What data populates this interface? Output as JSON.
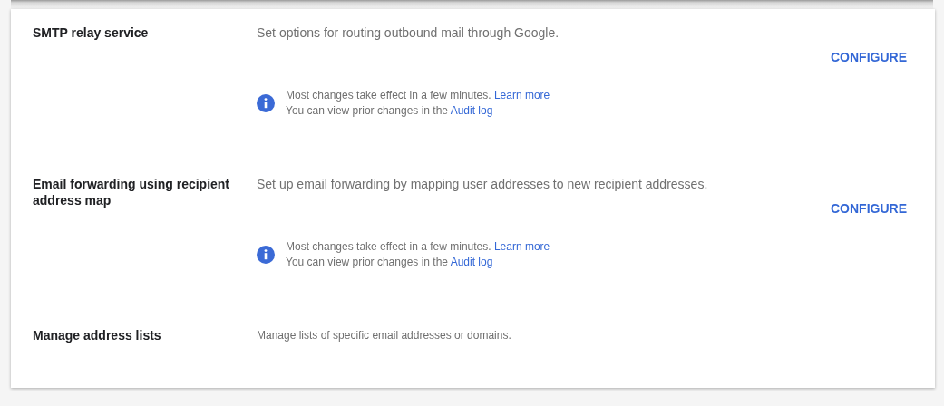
{
  "sections": [
    {
      "kind": "configurable",
      "title": "SMTP relay service",
      "description": "Set options for routing outbound mail through Google.",
      "action": "CONFIGURE",
      "notice": {
        "lines": [
          {
            "text": "Most changes take effect in a few minutes.",
            "link": "Learn more"
          },
          {
            "text": "You can view prior changes in the",
            "link": "Audit log"
          }
        ]
      }
    },
    {
      "kind": "configurable",
      "title": "Email forwarding using recipient address map",
      "description": "Set up email forwarding by mapping user addresses to new recipient addresses.",
      "action": "CONFIGURE",
      "notice": {
        "lines": [
          {
            "text": "Most changes take effect in a few minutes.",
            "link": "Learn more"
          },
          {
            "text": "You can view prior changes in the",
            "link": "Audit log"
          }
        ]
      }
    },
    {
      "kind": "summary",
      "title": "Manage address lists",
      "description": "Manage lists of specific email addresses or domains."
    }
  ]
}
